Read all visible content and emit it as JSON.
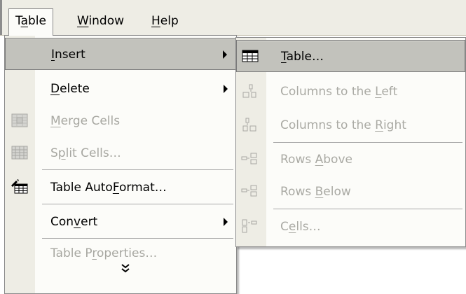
{
  "menubar": {
    "items": [
      {
        "pre": "T",
        "u": "a",
        "post": "ble"
      },
      {
        "pre": "",
        "u": "W",
        "post": "indow"
      },
      {
        "pre": "",
        "u": "H",
        "post": "elp"
      }
    ]
  },
  "table_menu": {
    "items": [
      {
        "pre": "",
        "u": "I",
        "post": "nsert"
      },
      {
        "pre": "",
        "u": "D",
        "post": "elete"
      },
      {
        "pre": "",
        "u": "M",
        "post": "erge Cells"
      },
      {
        "pre": "S",
        "u": "p",
        "post": "lit Cells…"
      },
      {
        "pre": "Table Auto",
        "u": "F",
        "post": "ormat…"
      },
      {
        "pre": "Con",
        "u": "v",
        "post": "ert"
      },
      {
        "pre": "Table P",
        "u": "r",
        "post": "operties…"
      }
    ],
    "expand_glyph": "≫"
  },
  "insert_submenu": {
    "items": [
      {
        "pre": "",
        "u": "T",
        "post": "able…"
      },
      {
        "pre": "Columns to the ",
        "u": "L",
        "post": "eft"
      },
      {
        "pre": "Columns to the ",
        "u": "R",
        "post": "ight"
      },
      {
        "pre": "Rows ",
        "u": "A",
        "post": "bove"
      },
      {
        "pre": "Rows ",
        "u": "B",
        "post": "elow"
      },
      {
        "pre": "C",
        "u": "e",
        "post": "lls…"
      }
    ]
  },
  "colors": {
    "menu_bg": "#fcfcf9",
    "gutter_bg": "#eeede5",
    "highlight_bg": "#c2c2bc",
    "disabled_text": "#a7a7a1"
  }
}
